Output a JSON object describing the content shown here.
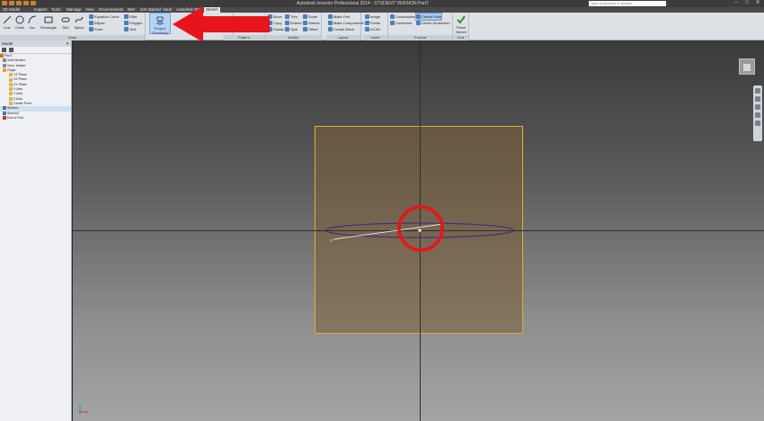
{
  "window": {
    "title": "Autodesk Inventor Professional 2014 - STUDENT VERSION    Part7",
    "search_placeholder": "Type a keyword or phrase"
  },
  "ribbon_tabs": [
    "3D Model",
    "Inspect",
    "Tools",
    "Manage",
    "View",
    "Environments",
    "BIM",
    "Get Started",
    "Vault",
    "Autodesk 360",
    "Sketch"
  ],
  "ribbon": {
    "draw": {
      "label": "Draw",
      "line": "Line",
      "circle": "Circle",
      "arc": "Arc",
      "rectangle": "Rectangle",
      "slot": "Slot",
      "spline": "Spline",
      "equation_curve": "Equation Curve",
      "fillet": "Fillet",
      "ellipse": "Ellipse",
      "polygon": "Polygon",
      "point": "Point",
      "text": "Text"
    },
    "project_geometry": "Project Geometry",
    "modify": {
      "label": "Modify",
      "move": "Move",
      "trim": "Trim",
      "scale": "Scale",
      "copy": "Copy",
      "extend": "Extend",
      "stretch": "Stretch",
      "rotate": "Rotate",
      "split": "Split",
      "offset": "Offset"
    },
    "pattern_label": "Pattern",
    "layout": {
      "label": "Layout",
      "make_part": "Make Part",
      "make_components": "Make Components",
      "create_block": "Create Block"
    },
    "insert": {
      "label": "Insert",
      "image": "Image",
      "points": "Points",
      "acad": "ACAD"
    },
    "format": {
      "label": "Format",
      "construction": "Construction",
      "centerline": "Centerline",
      "center_point": "Center Point",
      "driven_dimension": "Driven Dimension"
    },
    "exit": {
      "label": "Exit",
      "finish_sketch": "Finish Sketch"
    }
  },
  "browser": {
    "title": "Model",
    "items": [
      "Part7",
      "Solid Bodies",
      "View: Master",
      "Origin",
      "YZ Plane",
      "XZ Plane",
      "XY Plane",
      "X Axis",
      "Y Axis",
      "Z Axis",
      "Center Point",
      "Sketch1",
      "Sketch2",
      "End of Part"
    ]
  },
  "icons": {
    "close": "close-icon",
    "filter": "filter-icon",
    "search": "search-icon"
  },
  "colors": {
    "plane_border": "#d6b33b",
    "annotation_red": "#e8141b",
    "ellipse": "#4c2f7a"
  }
}
